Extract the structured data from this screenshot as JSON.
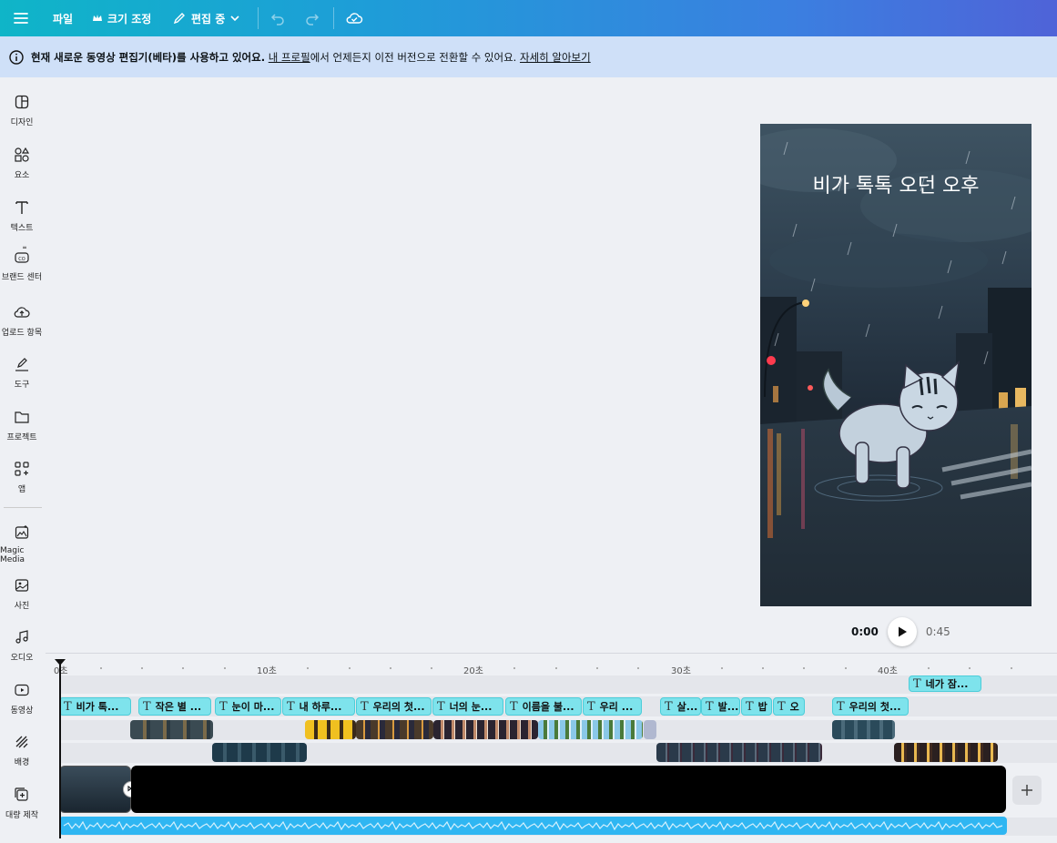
{
  "topbar": {
    "menu_icon": "hamburger-icon",
    "file_label": "파일",
    "resize_label": "크기 조정",
    "edit_mode_label": "편집 중"
  },
  "banner": {
    "text_bold": "현재 새로운 동영상 편집기(베타)를 사용하고 있어요.",
    "link_profile": "내 프로필",
    "text_mid": "에서 언제든지 이전 버전으로 전환할 수 있어요.",
    "link_learn": "자세히 알아보기"
  },
  "sidebar": {
    "items": [
      {
        "label": "디자인",
        "icon": "design-icon"
      },
      {
        "label": "요소",
        "icon": "elements-icon"
      },
      {
        "label": "텍스트",
        "icon": "text-icon"
      },
      {
        "label": "브랜드 센터",
        "icon": "brand-icon"
      },
      {
        "label": "업로드 항목",
        "icon": "upload-icon"
      },
      {
        "label": "도구",
        "icon": "draw-icon"
      },
      {
        "label": "프로젝트",
        "icon": "folder-icon"
      },
      {
        "label": "앱",
        "icon": "apps-icon"
      },
      {
        "label": "Magic Media",
        "icon": "magic-media-icon"
      },
      {
        "label": "사진",
        "icon": "photo-icon"
      },
      {
        "label": "오디오",
        "icon": "audio-icon"
      },
      {
        "label": "동영상",
        "icon": "video-icon"
      },
      {
        "label": "배경",
        "icon": "background-icon"
      },
      {
        "label": "대량 제작",
        "icon": "bulk-create-icon"
      }
    ]
  },
  "preview": {
    "title": "비가 톡톡 오던 오후"
  },
  "player": {
    "current_time": "0:00",
    "duration": "0:45"
  },
  "timeline": {
    "ruler": [
      "0초",
      "10초",
      "20초",
      "30초",
      "40초"
    ],
    "text_clips_top": [
      {
        "label": "네가 잠..."
      }
    ],
    "text_clips": [
      {
        "label": "비가 톡..."
      },
      {
        "label": "작은 별 ..."
      },
      {
        "label": "눈이 마..."
      },
      {
        "label": "내 하루..."
      },
      {
        "label": "우리의 첫..."
      },
      {
        "label": "너의 눈..."
      },
      {
        "label": "이름을 불..."
      },
      {
        "label": "우리 ..."
      },
      {
        "label": "살..."
      },
      {
        "label": "발..."
      },
      {
        "label": "밥"
      },
      {
        "label": "오"
      },
      {
        "label": "우리의 첫..."
      }
    ]
  },
  "colors": {
    "accent": "#1e9dd8",
    "text_clip": "#7ee3ec",
    "audio": "#2fb6f2"
  }
}
